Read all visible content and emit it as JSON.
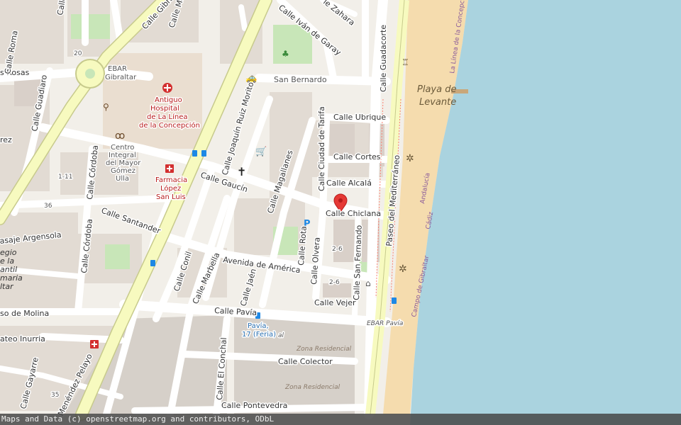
{
  "map": {
    "attribution": "Maps and Data (c) openstreetmap.org and contributors, ODbL",
    "colors": {
      "sea": "#aad3df",
      "beach": "#f5dcae",
      "land": "#f2efe9",
      "road_major": "#f7fabf",
      "road_major_casing": "#c7ca8c",
      "road": "#ffffff",
      "building": "#d9d0c9",
      "marker": "#e53935"
    },
    "marker": {
      "label": "Calle Chiclana",
      "icon": "map-pin-icon"
    },
    "water_labels": {
      "beach_name_1": "Playa de",
      "beach_name_2": "Levante",
      "municipality_coast": "La Línea de la Concepción",
      "admin_region": "Andalucía",
      "admin_province": "Cádiz",
      "admin_comarca": "Campo de Gibraltar"
    },
    "pois": {
      "ebar_gibraltar_1": "EBAR",
      "ebar_gibraltar_2": "Gibraltar",
      "hospital_1": "Antiguo",
      "hospital_2": "Hospital",
      "hospital_3": "de La Línea",
      "hospital_4": "de la Concepción",
      "centro_1": "Centro",
      "centro_2": "Integral",
      "centro_3": "del Mayor",
      "centro_4": "Gómez",
      "centro_5": "Ulla",
      "farmacia_1": "Farmacia",
      "farmacia_2": "López",
      "farmacia_3": "San Luis",
      "san_bernardo": "San Bernardo",
      "pavia_feria_1": "Pavía,",
      "pavia_feria_2": "17 (Feria)",
      "ebar_pavia": "EBAR Pavía",
      "zona_residencial_1": "Zona Residencial",
      "zona_residencial_2": "Zona Residencial",
      "house_20": "20",
      "house_111": "1-11",
      "house_36": "36",
      "house_26a": "2-6",
      "house_26b": "2-6",
      "house_35": "35",
      "al": "al"
    },
    "streets": {
      "rosas": "s Rosas",
      "roma": "Calle Roma",
      "guadiaro": "Calle Guadiaro",
      "rez": "rez",
      "gibraltar": "Calle Gibraltar",
      "medina": "Calle Medina",
      "ivan_garay": "Calle Iván de Garay",
      "zahara": "le Zahara",
      "calle_top": "Calle",
      "guadacorte": "Calle Guadacorte",
      "joaquin_ruiz_morito": "Calle Joaquín Ruiz Morito",
      "ubrique": "Calle Ubrique",
      "ciudad_tarifa": "Calle Ciudad de Tarifa",
      "cortes": "Calle Cortes",
      "gaucin": "Calle Gaucín",
      "magallanes": "Calle Magallanes",
      "alcala": "Calle Alcalá",
      "paseo_mediterraneo": "Paseo del Mediterráneo",
      "cordoba_1": "Calle Córdoba",
      "cordoba_2": "Calle Córdoba",
      "santander": "Calle Santander",
      "argensola": "asaje Argensola",
      "conil": "Calle Conil",
      "marbella": "Calle Marbella",
      "avenida_america": "Avenida de América",
      "jaen": "Calle Jaén",
      "rota": "Calle Rota",
      "olvera": "Calle Olvera",
      "san_fernando": "Calle San Fernando",
      "vejer": "Calle Vejer",
      "pavia": "Calle Pavía",
      "molina": "so de Molina",
      "mateo_inurria": "ateo Inurria",
      "el_conchal": "Calle El Conchal",
      "colector": "Calle Colector",
      "gayarre": "Calle Gayarre",
      "menendez_pelayo": "Menéndez Pelayo",
      "pontevedra": "Calle Pontevedra",
      "colegio_1": "egio",
      "colegio_2": "e la",
      "colegio_3": "antil",
      "colegio_4": "maria",
      "colegio_5": "ltar"
    }
  }
}
